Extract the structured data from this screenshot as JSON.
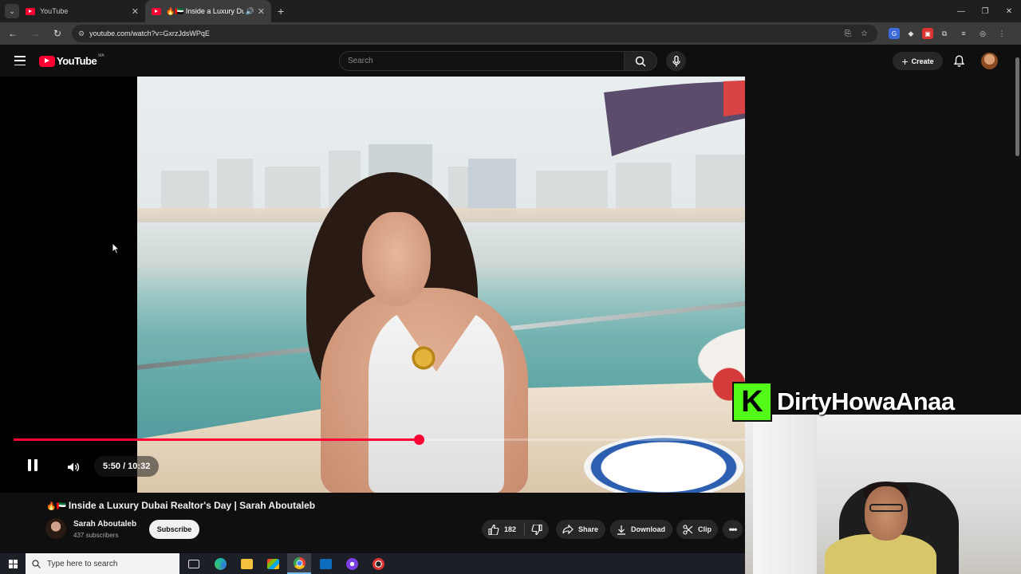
{
  "browser": {
    "tabs": [
      {
        "title": "YouTube",
        "active": false
      },
      {
        "title": "🔥🇦🇪 Inside a Luxury Dubai",
        "active": true
      }
    ],
    "url": "youtube.com/watch?v=GxrzJdsWPqE"
  },
  "youtube": {
    "logo_text": "YouTube",
    "country_code": "MA",
    "search_placeholder": "Search",
    "create_label": "Create"
  },
  "player": {
    "current_time": "5:50",
    "duration": "10:32",
    "time_display": "5:50 / 10:32",
    "progress_fraction": 0.5538,
    "state": "playing",
    "accent_color": "#ff0033"
  },
  "video": {
    "title_prefix": "🔥🇦🇪",
    "title": "Inside a Luxury Dubai Realtor's Day | Sarah Aboutaleb",
    "channel_name": "Sarah Aboutaleb",
    "subscribers": "437 subscribers",
    "subscribe_label": "Subscribe",
    "likes": "182",
    "share_label": "Share",
    "download_label": "Download",
    "clip_label": "Clip"
  },
  "overlay": {
    "streamer_name": "DirtyHowaAnaa",
    "badge_letter": "K",
    "badge_color": "#53fc18"
  },
  "taskbar": {
    "search_placeholder": "Type here to search",
    "apps": [
      "task-view-icon",
      "edge-icon",
      "file-explorer-icon",
      "store-icon",
      "chrome-icon",
      "outlook-icon",
      "app-icon",
      "app-icon"
    ]
  }
}
